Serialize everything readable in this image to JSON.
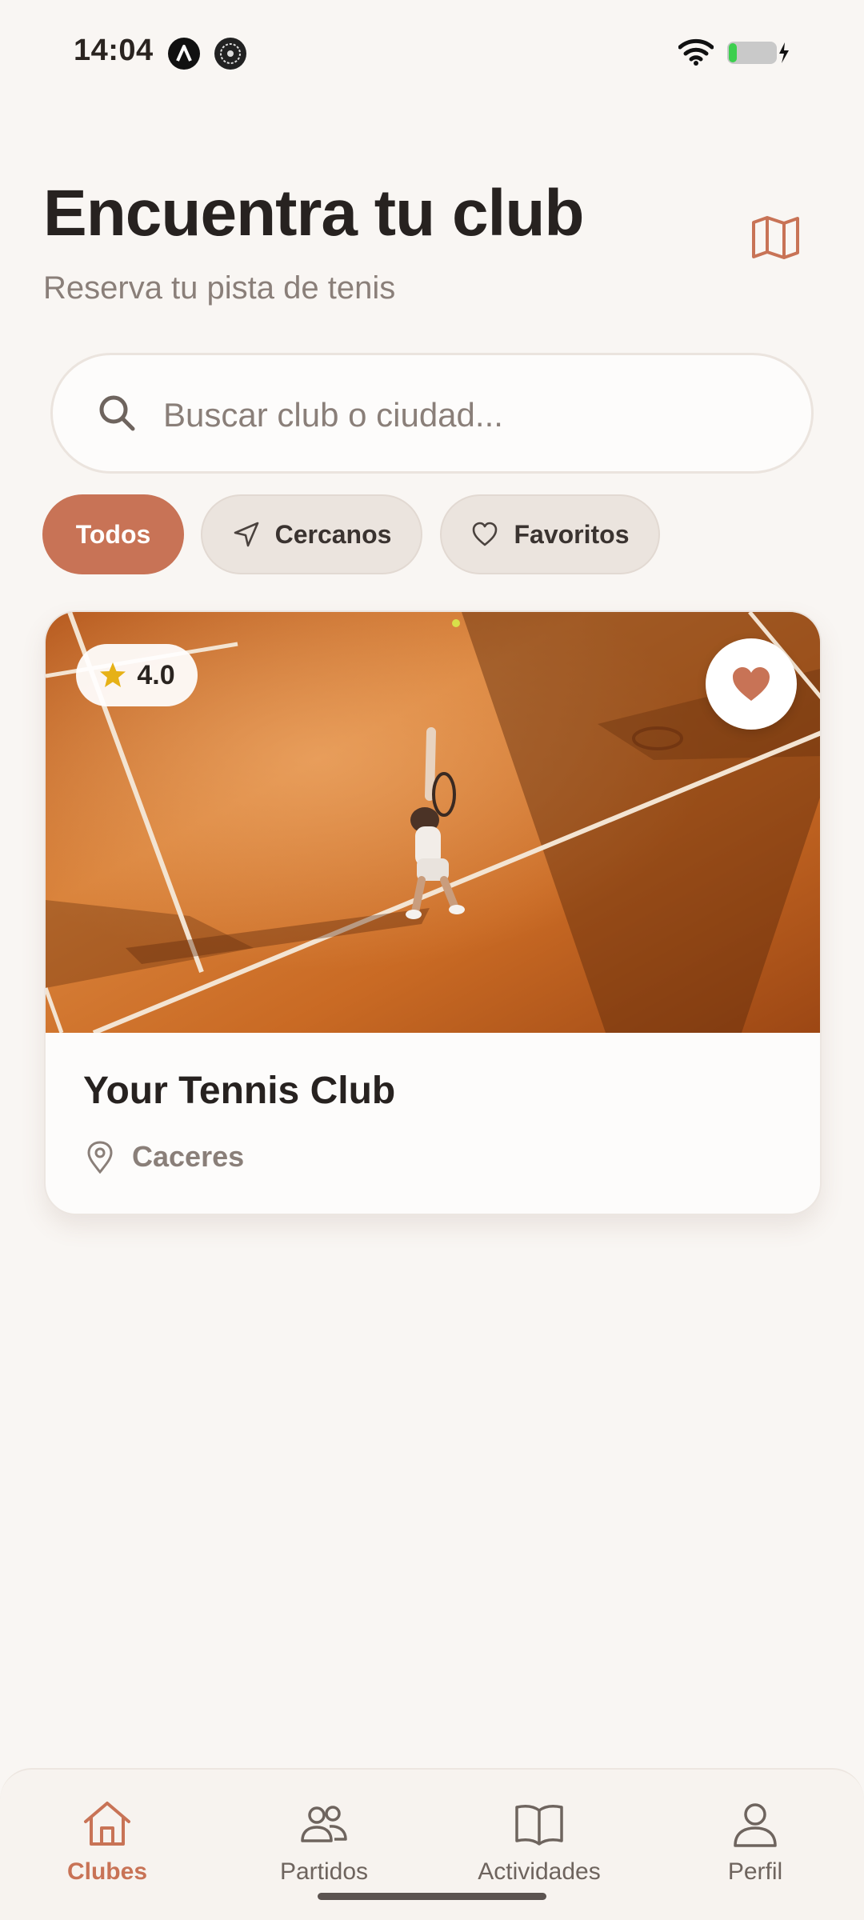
{
  "status_bar": {
    "time": "14:04"
  },
  "header": {
    "title": "Encuentra tu club",
    "subtitle": "Reserva tu pista de tenis"
  },
  "search": {
    "placeholder": "Buscar club o ciudad...",
    "value": ""
  },
  "filters": [
    {
      "label": "Todos",
      "active": true
    },
    {
      "label": "Cercanos",
      "icon": "navigation-arrow-icon",
      "active": false
    },
    {
      "label": "Favoritos",
      "icon": "heart-outline-icon",
      "active": false
    }
  ],
  "clubs": [
    {
      "name": "Your Tennis Club",
      "city": "Caceres",
      "rating": "4.0",
      "favorite": true
    }
  ],
  "bottom_nav": [
    {
      "label": "Clubes",
      "icon": "home-icon",
      "active": true
    },
    {
      "label": "Partidos",
      "icon": "users-icon",
      "active": false
    },
    {
      "label": "Actividades",
      "icon": "book-icon",
      "active": false
    },
    {
      "label": "Perfil",
      "icon": "user-icon",
      "active": false
    }
  ],
  "colors": {
    "accent": "#c87356",
    "background": "#f9f6f3",
    "text_primary": "#272220",
    "text_secondary": "#8a7f79",
    "star": "#e6b117"
  }
}
